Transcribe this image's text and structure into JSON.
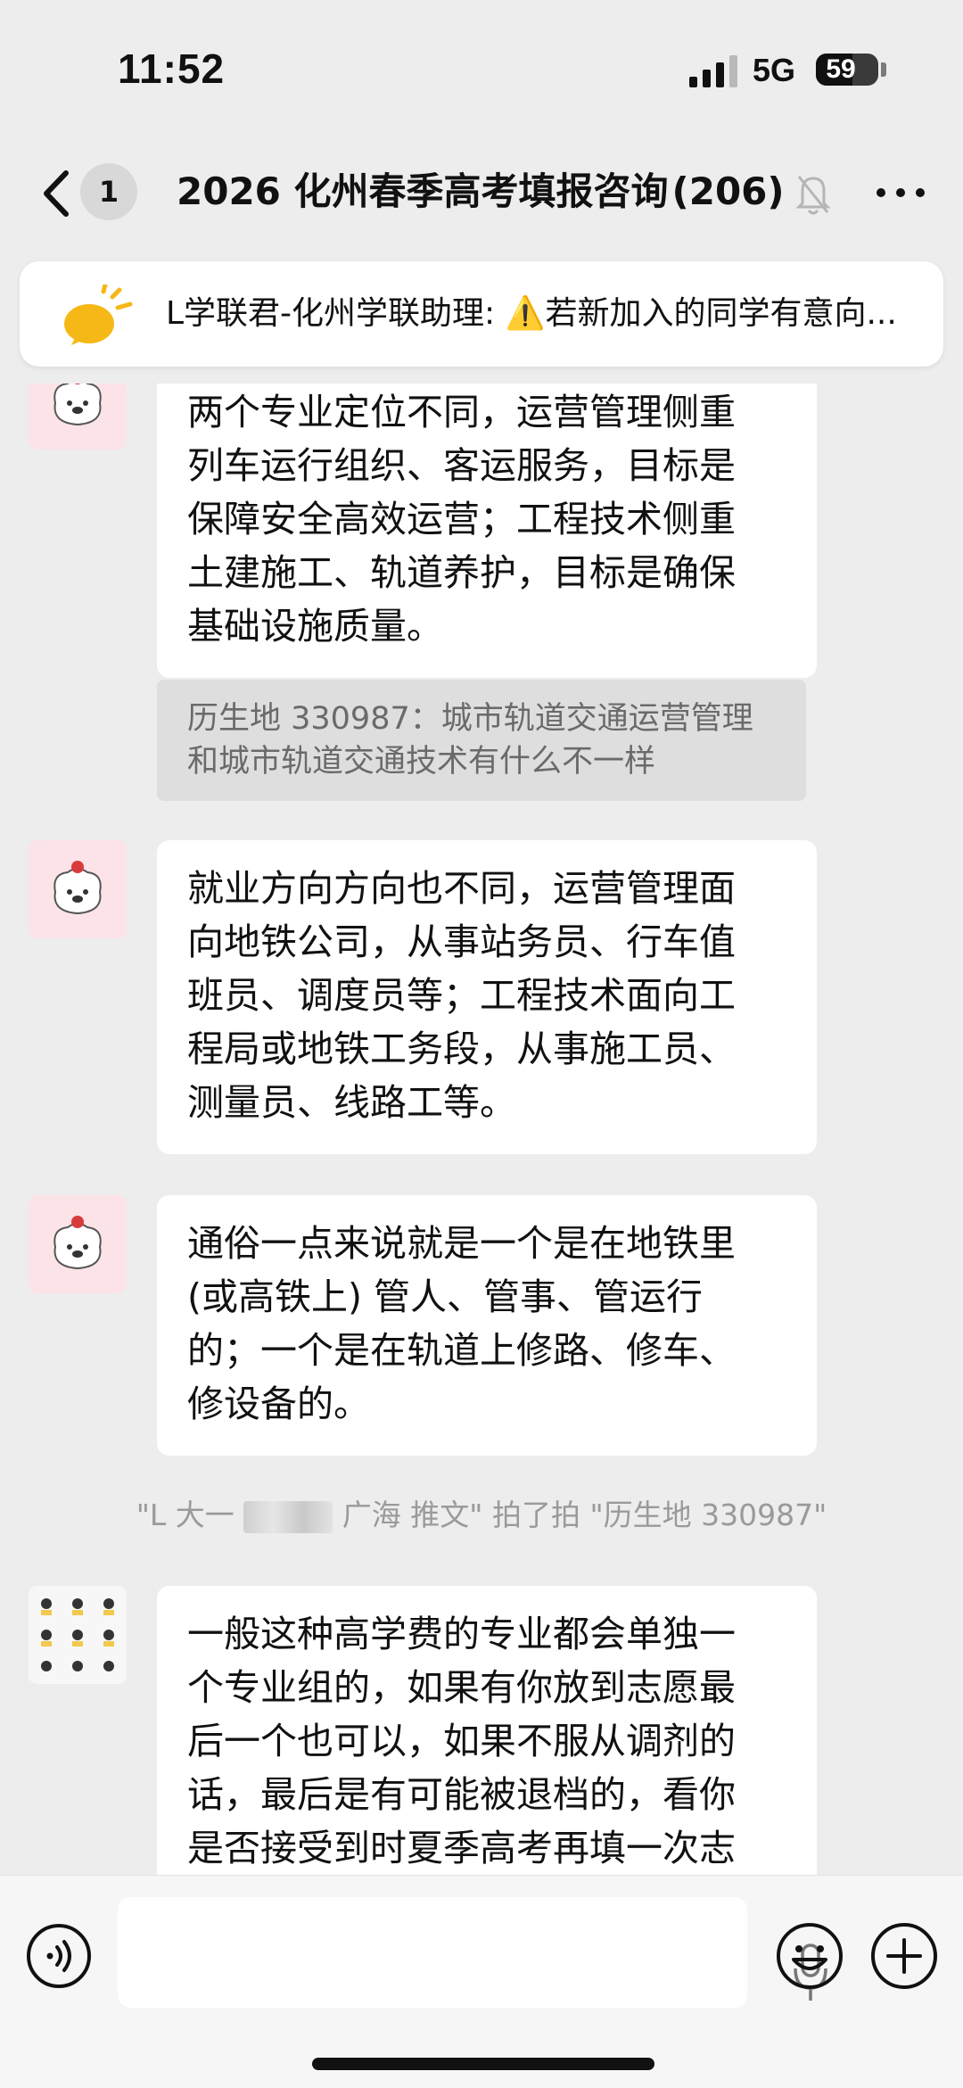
{
  "status_bar": {
    "time": "11:52",
    "network": "5G",
    "battery": "59",
    "battery_level": 0.59,
    "signal_bars": 4,
    "signal_active": 3
  },
  "header": {
    "unread_count": "1",
    "title": "2026 化州春季高考填报咨询",
    "member_count": "(206)"
  },
  "pinned": {
    "sender": "L学联君-化州学联助理:",
    "warning_icon": "⚠️",
    "text": "若新加入的同学有意向..."
  },
  "messages": {
    "m1": {
      "lines": [
        "两个专业定位不同，运营管理侧重",
        "列车运行组织、客运服务，目标是",
        "保障安全高效运营；工程技术侧重",
        "土建施工、轨道养护，目标是确保",
        "基础设施质量。"
      ]
    },
    "m1_quote": {
      "lines": [
        "历生地 330987：城市轨道交通运营管理",
        "和城市轨道交通技术有什么不一样"
      ]
    },
    "m2": {
      "lines": [
        "就业方向方向也不同，运营管理面",
        "向地铁公司，从事站务员、行车值",
        "班员、调度员等；工程技术面向工",
        "程局或地铁工务段，从事施工员、",
        "测量员、线路工等。"
      ]
    },
    "m3": {
      "lines": [
        "通俗一点来说就是一个是在地铁里",
        "(或高铁上) 管人、管事、管运行",
        "的；一个是在轨道上修路、修车、",
        "修设备的。"
      ]
    },
    "system_pat": {
      "before": "\"L 大一",
      "after": "广海 推文\" 拍了拍 \"历生地 330987\""
    },
    "m4": {
      "lines": [
        "一般这种高学费的专业都会单独一",
        "个专业组的，如果有你放到志愿最",
        "后一个也可以，如果不服从调剂的",
        "话，最后是有可能被退档的，看你",
        "是否接受到时夏季高考再填一次志"
      ]
    }
  },
  "icons": {
    "back": "chevron-left-icon",
    "mute": "bell-off-icon",
    "more": "more-dots-icon",
    "announcement": "speaker-icon",
    "voice": "voice-icon",
    "mic": "microphone-icon",
    "emoji": "emoji-icon",
    "plus": "plus-icon"
  },
  "colors": {
    "background": "#ededed",
    "bubble": "#ffffff",
    "quote": "#dedede",
    "announcement_icon": "#f6b817"
  }
}
